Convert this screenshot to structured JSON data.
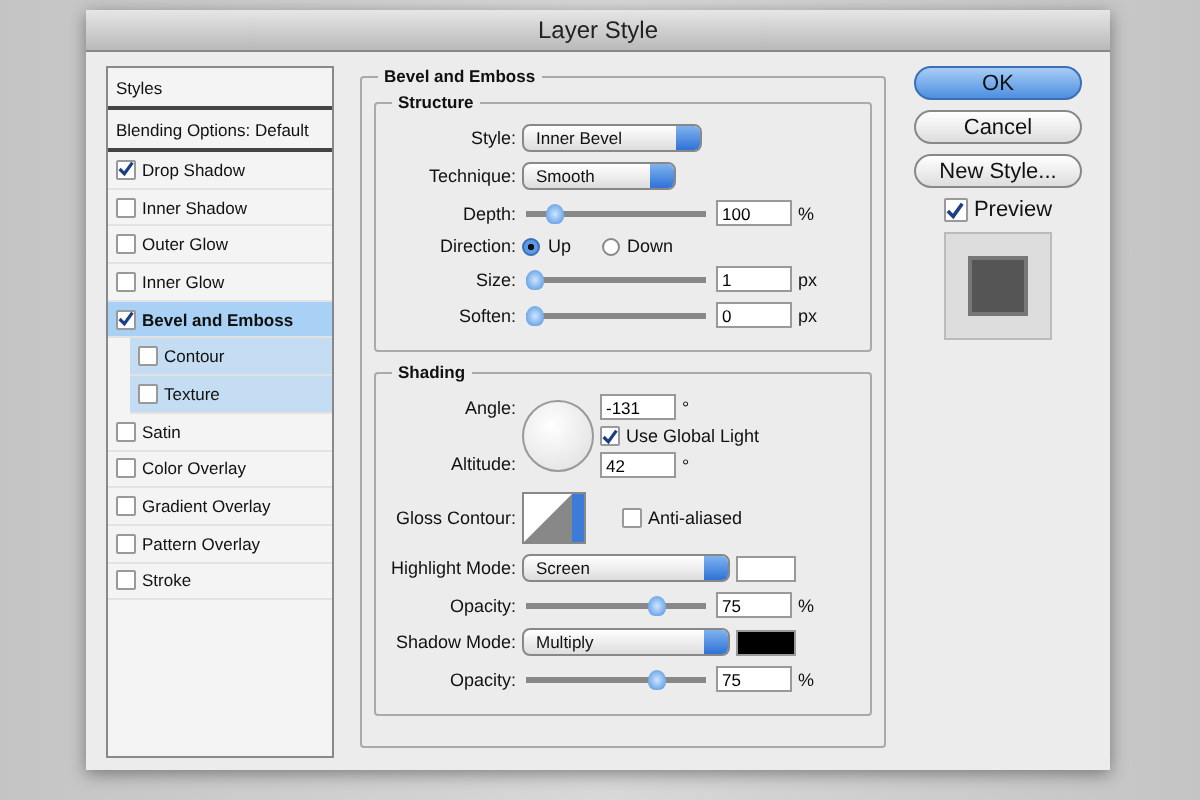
{
  "window": {
    "title": "Layer Style"
  },
  "styles_header": "Styles",
  "blending_options": "Blending Options: Default",
  "effects": [
    {
      "label": "Drop Shadow",
      "checked": true,
      "selected": false
    },
    {
      "label": "Inner Shadow",
      "checked": false,
      "selected": false
    },
    {
      "label": "Outer Glow",
      "checked": false,
      "selected": false
    },
    {
      "label": "Inner Glow",
      "checked": false,
      "selected": false
    },
    {
      "label": "Bevel and Emboss",
      "checked": true,
      "selected": true,
      "children": [
        {
          "label": "Contour",
          "checked": false,
          "selected": false
        },
        {
          "label": "Texture",
          "checked": false,
          "selected": false
        }
      ]
    },
    {
      "label": "Satin",
      "checked": false,
      "selected": false
    },
    {
      "label": "Color Overlay",
      "checked": false,
      "selected": false
    },
    {
      "label": "Gradient Overlay",
      "checked": false,
      "selected": false
    },
    {
      "label": "Pattern Overlay",
      "checked": false,
      "selected": false
    },
    {
      "label": "Stroke",
      "checked": false,
      "selected": false
    }
  ],
  "bevel": {
    "title": "Bevel and Emboss",
    "structure": {
      "title": "Structure",
      "style": {
        "label": "Style:",
        "value": "Inner Bevel"
      },
      "technique": {
        "label": "Technique:",
        "value": "Smooth"
      },
      "depth": {
        "label": "Depth:",
        "level": 0.12,
        "value": "100",
        "unit": "%"
      },
      "direction": {
        "label": "Direction:",
        "options": [
          {
            "label": "Up",
            "selected": true
          },
          {
            "label": "Down",
            "selected": false
          }
        ]
      },
      "size": {
        "label": "Size:",
        "level": 0,
        "value": "1",
        "unit": "px"
      },
      "soften": {
        "label": "Soften:",
        "level": 0,
        "value": "0",
        "unit": "px"
      }
    },
    "shading": {
      "title": "Shading",
      "angle": {
        "label": "Angle:",
        "value": "-131",
        "unit": "°"
      },
      "use_global_light": {
        "label": "Use Global Light",
        "checked": true
      },
      "altitude": {
        "label": "Altitude:",
        "value": "42",
        "unit": "°"
      },
      "gloss_contour": {
        "label": "Gloss Contour:"
      },
      "anti_aliased": {
        "label": "Anti-aliased",
        "checked": false
      },
      "highlight_mode": {
        "label": "Highlight Mode:",
        "value": "Screen",
        "color": "#ffffff"
      },
      "highlight_opacity": {
        "label": "Opacity:",
        "level": 0.75,
        "value": "75",
        "unit": "%"
      },
      "shadow_mode": {
        "label": "Shadow Mode:",
        "value": "Multiply",
        "color": "#000000"
      },
      "shadow_opacity": {
        "label": "Opacity:",
        "level": 0.75,
        "value": "75",
        "unit": "%"
      }
    }
  },
  "buttons": [
    {
      "label": "OK",
      "default": true
    },
    {
      "label": "Cancel",
      "default": false
    },
    {
      "label": "New Style...",
      "default": false
    }
  ],
  "preview": {
    "label": "Preview",
    "checked": true
  }
}
